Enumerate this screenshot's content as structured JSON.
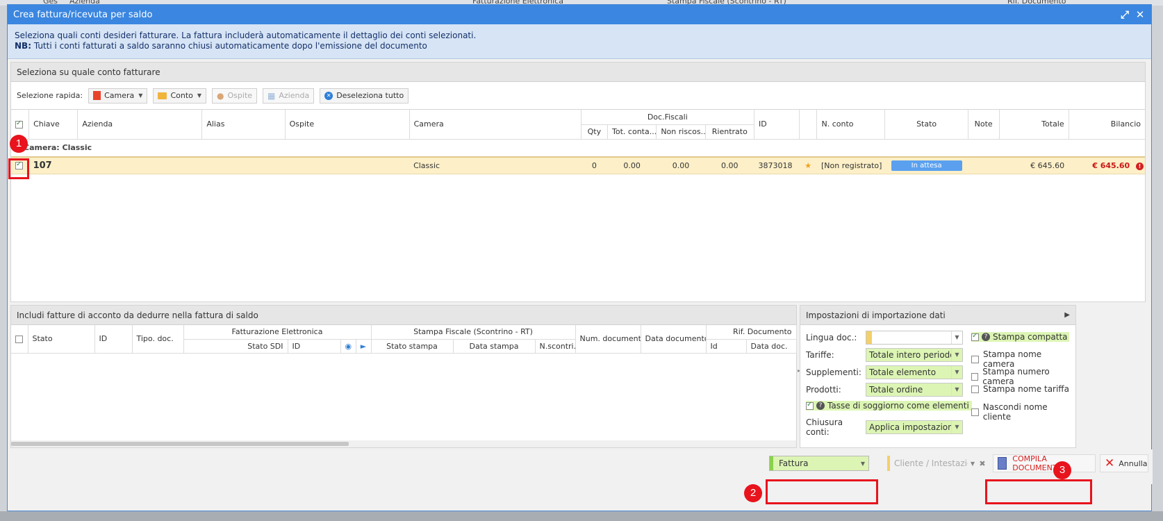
{
  "background": {
    "items": [
      "Ges",
      "Azienda",
      "Fatturazione Elettronica",
      "Stampa Fiscale (Scontrino - RT)",
      "Rif. Documento"
    ]
  },
  "dialog": {
    "title": "Crea fattura/ricevuta per saldo",
    "info_line1": "Seleziona quali conti desideri fatturare. La fattura includerà automaticamente il dettaglio dei conti selezionati.",
    "info_nb": "NB:",
    "info_line2": " Tutti i conti fatturati a saldo saranno chiusi automaticamente dopo l'emissione del documento"
  },
  "accounts": {
    "section_title": "Seleziona su quale conto fatturare",
    "quick_label": "Selezione rapida:",
    "btn_camera": "Camera",
    "btn_conto": "Conto",
    "btn_ospite": "Ospite",
    "btn_azienda": "Azienda",
    "btn_deselect": "Deseleziona tutto",
    "columns": {
      "chiave": "Chiave",
      "azienda": "Azienda",
      "alias": "Alias",
      "ospite": "Ospite",
      "camera": "Camera",
      "doc_fiscali": "Doc.Fiscali",
      "qty": "Qty",
      "tot_conta": "Tot. conta...",
      "non_risc": "Non riscos..",
      "rientrato": "Rientrato",
      "id": "ID",
      "n_conto": "N. conto",
      "stato": "Stato",
      "note": "Note",
      "totale": "Totale",
      "bilancio": "Bilancio"
    },
    "group_label": "Camera: Classic",
    "row": {
      "chiave": "107",
      "camera": "Classic",
      "qty": "0",
      "tot_conta": "0.00",
      "non_risc": "0.00",
      "rientrato": "0.00",
      "id": "3873018",
      "n_conto": "[Non registrato]",
      "stato": "In attesa",
      "totale": "€ 645.60",
      "bilancio": "€ 645.60"
    }
  },
  "deposits": {
    "section_title": "Includi fatture di acconto da dedurre nella fattura di saldo",
    "columns": {
      "stato": "Stato",
      "id": "ID",
      "tipo_doc": "Tipo. doc.",
      "fatt_el": "Fatturazione Elettronica",
      "stato_sdi": "Stato SDI",
      "id2": "ID",
      "stampa": "Stampa Fiscale (Scontrino - RT)",
      "stato_stampa": "Stato stampa",
      "data_stampa": "Data stampa",
      "n_scontrini": "N.scontri...",
      "num_doc": "Num. documento",
      "data_doc": "Data documento",
      "rif_doc": "Rif. Documento",
      "rif_id": "Id",
      "rif_data": "Data doc."
    }
  },
  "settings": {
    "title": "Impostazioni di importazione dati",
    "lingua_label": "Lingua doc.:",
    "lingua_value": "",
    "tariffe_label": "Tariffe:",
    "tariffe_value": "Totale intero periodo",
    "supplementi_label": "Supplementi:",
    "supplementi_value": "Totale elemento",
    "prodotti_label": "Prodotti:",
    "prodotti_value": "Totale ordine",
    "tasse_label": "Tasse di soggiorno come elementi",
    "chiusura_label": "Chiusura conti:",
    "chiusura_value": "Applica impostazioni di",
    "stampa_compatta": "Stampa compatta",
    "stampa_nome_camera": "Stampa nome camera",
    "stampa_numero_camera": "Stampa numero camera",
    "stampa_nome_tariffa": "Stampa nome tariffa",
    "nascondi_nome_cliente": "Nascondi nome cliente"
  },
  "footer": {
    "doc_type": "Fattura",
    "cliente_placeholder": "Cliente / Intestazio",
    "compile_label": "COMPILA DOCUMENTO",
    "annulla_label": "Annulla"
  },
  "annotations": [
    "1",
    "2",
    "3"
  ]
}
